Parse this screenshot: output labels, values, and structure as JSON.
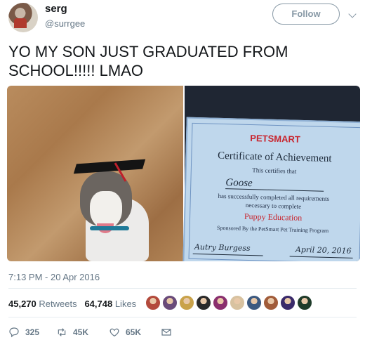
{
  "header": {
    "display_name": "serg",
    "handle": "@surrgee",
    "follow_label": "Follow"
  },
  "tweet": {
    "text": "YO MY SON JUST GRADUATED FROM SCHOOL!!!!! LMAO",
    "timestamp": "7:13 PM - 20 Apr 2016"
  },
  "media": {
    "certificate": {
      "logo": "PETSMART",
      "title": "Certificate of Achievement",
      "certifies": "This certifies that",
      "name": "Goose",
      "completed_line1": "has successfully completed all requirements",
      "completed_line2": "necessary to complete",
      "course": "Puppy Education",
      "sponsor": "Sponsored By the PetSmart Pet Training Program",
      "date": "April 20, 2016"
    }
  },
  "stats": {
    "retweets_count": "45,270",
    "retweets_label": "Retweets",
    "likes_count": "64,748",
    "likes_label": "Likes",
    "liker_colors": [
      "#b34a3c",
      "#6a4b7a",
      "#c9a24a",
      "#2a2a2a",
      "#8a2f6e",
      "#d8c2a0",
      "#3d5a80",
      "#a15c3a",
      "#3a2a6a",
      "#1f3b2a"
    ]
  },
  "actions": {
    "reply_count": "325",
    "retweet_count": "45K",
    "like_count": "65K"
  },
  "colors": {
    "secondary_text": "#657786",
    "primary_text": "#14171a",
    "divider": "#e6ecf0"
  }
}
